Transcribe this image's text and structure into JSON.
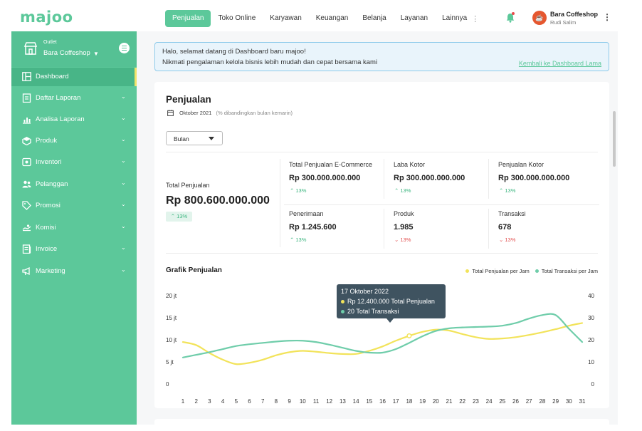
{
  "app": {
    "logo": "majoo"
  },
  "header": {
    "nav": [
      {
        "label": "Penjualan",
        "active": true
      },
      {
        "label": "Toko Online",
        "active": false
      },
      {
        "label": "Karyawan",
        "active": false
      },
      {
        "label": "Keuangan",
        "active": false
      },
      {
        "label": "Belanja",
        "active": false
      },
      {
        "label": "Layanan",
        "active": false
      },
      {
        "label": "Lainnya",
        "active": false
      }
    ],
    "more_icon": "vertical-dots-icon",
    "user": {
      "name": "Bara Coffeshop",
      "subtitle": "Rudi Salim"
    }
  },
  "sidebar": {
    "outlet_label": "Outlet",
    "outlet_name": "Bara Coffeshop",
    "items": [
      {
        "label": "Dashboard",
        "icon": "dashboard-icon",
        "active": true,
        "expandable": false
      },
      {
        "label": "Daftar Laporan",
        "icon": "report-list-icon",
        "active": false,
        "expandable": true
      },
      {
        "label": "Analisa Laporan",
        "icon": "analytics-icon",
        "active": false,
        "expandable": true
      },
      {
        "label": "Produk",
        "icon": "product-icon",
        "active": false,
        "expandable": true
      },
      {
        "label": "Inventori",
        "icon": "inventory-icon",
        "active": false,
        "expandable": true
      },
      {
        "label": "Pelanggan",
        "icon": "customer-icon",
        "active": false,
        "expandable": true
      },
      {
        "label": "Promosi",
        "icon": "promo-tag-icon",
        "active": false,
        "expandable": true
      },
      {
        "label": "Komisi",
        "icon": "commission-icon",
        "active": false,
        "expandable": true
      },
      {
        "label": "Invoice",
        "icon": "invoice-icon",
        "active": false,
        "expandable": true
      },
      {
        "label": "Marketing",
        "icon": "megaphone-icon",
        "active": false,
        "expandable": true
      }
    ]
  },
  "banner": {
    "line1": "Halo, selamat datang di Dashboard baru majoo!",
    "line2": "Nikmati pengalaman kelola bisnis lebih mudah dan cepat bersama kami",
    "link": "Kembali ke Dashboard Lama"
  },
  "sales": {
    "title": "Penjualan",
    "period": "Oktober 2021",
    "period_note": "(% dibandingkan bulan kemarin)",
    "filter": "Bulan",
    "total": {
      "label": "Total Penjualan",
      "value": "Rp 800.600.000.000",
      "change": "13%"
    },
    "stats": [
      {
        "label": "Total Penjualan E-Commerce",
        "value": "Rp 300.000.000.000",
        "change": "13%",
        "trend": "up"
      },
      {
        "label": "Laba Kotor",
        "value": "Rp 300.000.000.000",
        "change": "13%",
        "trend": "up"
      },
      {
        "label": "Penjualan Kotor",
        "value": "Rp 300.000.000.000",
        "change": "13%",
        "trend": "up"
      },
      {
        "label": "Penerimaan",
        "value": "Rp 1.245.600",
        "change": "13%",
        "trend": "up"
      },
      {
        "label": "Produk",
        "value": "1.985",
        "change": "13%",
        "trend": "down"
      },
      {
        "label": "Transaksi",
        "value": "678",
        "change": "13%",
        "trend": "down"
      }
    ]
  },
  "chart_data": {
    "type": "line",
    "title": "Grafik Penjualan",
    "x": [
      "1",
      "2",
      "3",
      "4",
      "5",
      "6",
      "7",
      "8",
      "9",
      "10",
      "11",
      "12",
      "13",
      "14",
      "15",
      "16",
      "17",
      "18",
      "19",
      "20",
      "21",
      "22",
      "23",
      "24",
      "25",
      "26",
      "27",
      "28",
      "29",
      "30",
      "31"
    ],
    "y_left": {
      "ticks": [
        "20 jt",
        "15 jt",
        "10 jt",
        "5 jt",
        "0"
      ],
      "range": [
        0,
        20
      ]
    },
    "y_right": {
      "ticks": [
        "40",
        "30",
        "20",
        "10",
        "0"
      ],
      "range": [
        0,
        40
      ]
    },
    "series": [
      {
        "name": "Total Penjualan per Jam",
        "color": "#f2e35a",
        "axis": "left",
        "values": [
          9.5,
          8.8,
          7.0,
          5.5,
          4.5,
          4.8,
          5.5,
          6.5,
          7.2,
          7.5,
          7.3,
          7.0,
          6.8,
          6.8,
          7.5,
          8.5,
          9.8,
          10.9,
          11.8,
          12.3,
          12.1,
          11.3,
          10.6,
          10.2,
          10.3,
          10.6,
          11.1,
          11.7,
          12.4,
          13.2,
          13.8
        ]
      },
      {
        "name": "Total Transaksi per Jam",
        "color": "#6fcdaa",
        "axis": "left",
        "values": [
          6.0,
          6.6,
          7.2,
          7.9,
          8.6,
          9.0,
          9.3,
          9.6,
          9.8,
          9.8,
          9.5,
          8.9,
          8.2,
          7.5,
          7.1,
          7.1,
          7.9,
          9.3,
          10.8,
          12.0,
          12.6,
          12.8,
          12.9,
          13.0,
          13.2,
          13.8,
          14.8,
          15.6,
          15.6,
          12.5,
          9.5
        ]
      }
    ],
    "tooltip": {
      "date": "17 Oktober 2022",
      "line1": "Rp 12.400.000 Total Penjualan",
      "line2": "20 Total Transaksi",
      "x_index": 17
    },
    "legend": "top-right",
    "grid": false
  }
}
